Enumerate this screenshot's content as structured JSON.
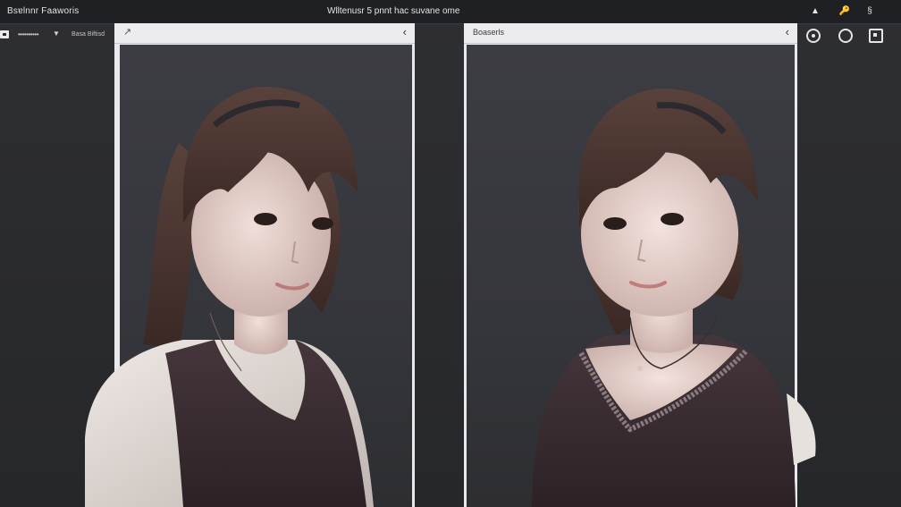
{
  "topbar": {
    "app_title": "Bsɐlnnr Faaworis",
    "window_title": "Wlltenusr 5 pnnt hac suvane  ome",
    "icons": [
      "eject-icon",
      "pin-icon",
      "link-icon"
    ]
  },
  "left_controls": {
    "dots_label": "••••••••••",
    "label": "Basa Biftisd"
  },
  "left_panel": {
    "header_icon": "↗",
    "back_icon": "chevron-left-icon"
  },
  "right_panel": {
    "header_text": "Boaserls",
    "back_icon": "chevron-left-icon"
  },
  "right_toolbar": {
    "icons": [
      "target-icon",
      "circle-icon",
      "square-icon"
    ]
  },
  "colors": {
    "background": "#2a2b2f",
    "topbar": "#1f2023",
    "panel": "#e9e9ec",
    "canvas": "#3a3b40",
    "hair": "#4a3530",
    "skin": "#e8d2cc",
    "top_garment": "#3a2d33",
    "blouse": "#e5e0dc"
  }
}
